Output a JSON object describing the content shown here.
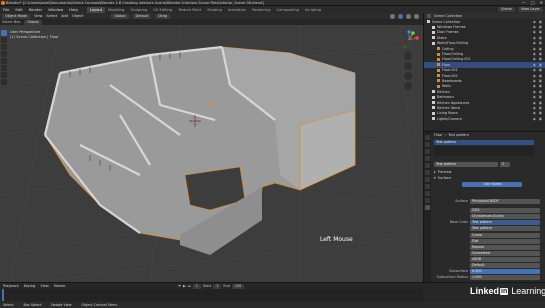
{
  "window": {
    "title": "Blender* [C:\\Users\\lanel\\Documents\\Online Courses\\Blender 2.8 Creating Interiors Scene\\Blender Interiors Scene Files\\Interior_Scene 06.blend]",
    "controls": [
      "—",
      "□",
      "✕"
    ]
  },
  "menubar": {
    "menus": [
      "File",
      "Edit",
      "Render",
      "Window",
      "Help"
    ],
    "workspaces": [
      "Layout",
      "Modeling",
      "Sculpting",
      "UV Editing",
      "Texture Paint",
      "Shading",
      "Animation",
      "Rendering",
      "Compositing",
      "Scripting"
    ],
    "active_workspace": "Layout",
    "scene": "Scene",
    "view_layer": "View Layer"
  },
  "viewport_header": {
    "mode": "Object Mode",
    "menus": [
      "View",
      "Select",
      "Add",
      "Object"
    ],
    "orientation": "Global",
    "transform": "Global",
    "pivot": "Default",
    "snap": "Drag",
    "select_box": "Select Box"
  },
  "viewport": {
    "perspective_label": "User Perspective",
    "collection_label": "(1) Scene Collection | Floor",
    "overlay_text": "Left Mouse"
  },
  "outliner": {
    "header": "Scene Collection",
    "rows": [
      {
        "name": "Scene Collection",
        "indent": 0,
        "selected": false
      },
      {
        "name": "Windows Frames",
        "indent": 1,
        "selected": false
      },
      {
        "name": "Door Frames",
        "indent": 1,
        "selected": false
      },
      {
        "name": "Stairs",
        "indent": 1,
        "selected": false
      },
      {
        "name": "Walls/Floor/Ceiling",
        "indent": 1,
        "selected": false
      },
      {
        "name": "Ceiling",
        "indent": 2,
        "selected": false
      },
      {
        "name": "Floor/Ceiling",
        "indent": 2,
        "selected": false
      },
      {
        "name": "Floor/Ceiling.001",
        "indent": 2,
        "selected": false
      },
      {
        "name": "Floor",
        "indent": 2,
        "selected": true
      },
      {
        "name": "Floor.001",
        "indent": 2,
        "selected": false
      },
      {
        "name": "Floor.002",
        "indent": 2,
        "selected": false
      },
      {
        "name": "Baseboards",
        "indent": 2,
        "selected": false
      },
      {
        "name": "Walls",
        "indent": 2,
        "selected": false
      },
      {
        "name": "Kitchen",
        "indent": 1,
        "selected": false
      },
      {
        "name": "Bathroom",
        "indent": 1,
        "selected": false
      },
      {
        "name": "Kitchen Appliances",
        "indent": 1,
        "selected": false
      },
      {
        "name": "Kitchen Items",
        "indent": 1,
        "selected": false
      },
      {
        "name": "Living Room",
        "indent": 1,
        "selected": false
      },
      {
        "name": "Lights/Camera",
        "indent": 1,
        "selected": false
      }
    ]
  },
  "properties": {
    "object": "Floor",
    "material_slot": "Test pattern",
    "material_name": "Test pattern",
    "user_count": "2",
    "panels": {
      "preview": "Preview",
      "surface": "Surface"
    },
    "use_nodes": "Use Nodes",
    "surface_shader": "Principled BSDF",
    "distribution": "GGX",
    "subsurface_method": "Christensen-Burley",
    "base_color_label": "Base Color",
    "base_color_value": "Test pattern",
    "image_name": "Test pattern",
    "fields": [
      {
        "label": "Linear",
        "value": "Linear"
      },
      {
        "label": "Flat",
        "value": "Flat"
      },
      {
        "label": "Repeat",
        "value": "Repeat"
      },
      {
        "label": "Generated",
        "value": "Generated"
      },
      {
        "label": "Color Space",
        "value": "sRGB"
      },
      {
        "label": "Vector",
        "value": "Default"
      }
    ],
    "subsurface_label": "Subsurface",
    "subsurface_value": "0.000",
    "subsurface_radius_label": "Subsurface Radius",
    "subsurface_radius_value": "1.000"
  },
  "timeline": {
    "menus": [
      "Playback",
      "Keying",
      "View",
      "Marker"
    ],
    "frame_current": "1",
    "start_label": "Start",
    "start": "1",
    "end_label": "End",
    "end": "250"
  },
  "statusbar": {
    "items": [
      "Select",
      "Box Select",
      "Rotate View",
      "Object Context Menu"
    ]
  },
  "watermark": {
    "brand_a": "Linked",
    "brand_b": "in",
    "brand_c": "Learning"
  }
}
